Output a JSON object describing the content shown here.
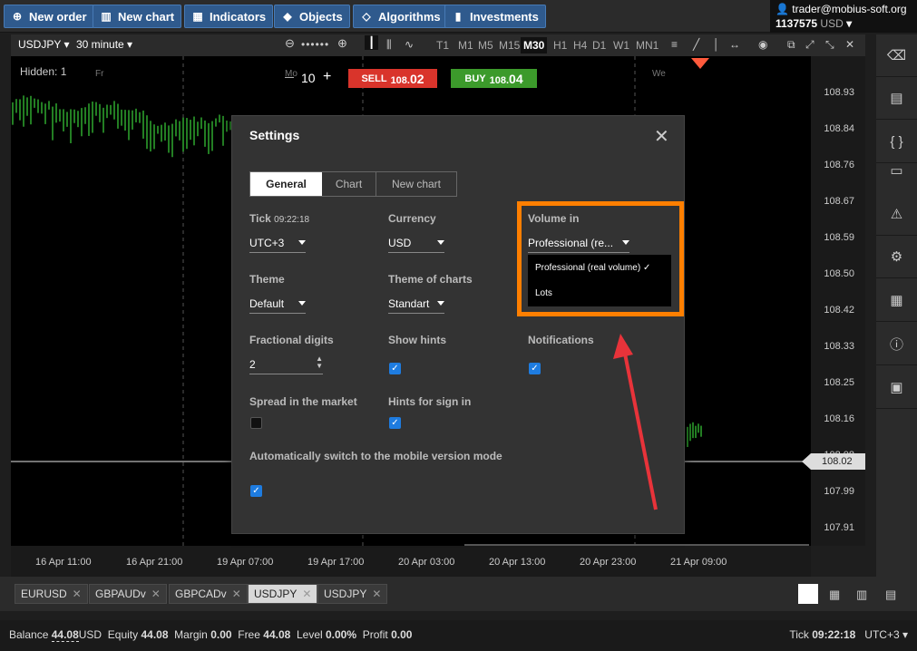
{
  "toolbar": {
    "new_order": "New order",
    "new_chart": "New chart",
    "indicators": "Indicators",
    "objects": "Objects",
    "algorithms": "Algorithms",
    "investments": "Investments"
  },
  "account": {
    "user": "trader@mobius-soft.org",
    "balance_line": "1137575",
    "currency": "USD"
  },
  "chart_toolbar": {
    "symbol": "USDJPY",
    "interval": "30 minute",
    "timeframes": [
      "T1",
      "M1",
      "M5",
      "M15",
      "M30",
      "H1",
      "H4",
      "D1",
      "W1",
      "MN1"
    ],
    "active_timeframe": "M30"
  },
  "chart": {
    "hidden_label": "Hidden: 1",
    "day_fr": "Fr",
    "day_mo": "Mo",
    "day_we": "We",
    "lot_value": "10",
    "sell_label": "SELL",
    "sell_price_main": "108.",
    "sell_price_big": "02",
    "buy_label": "BUY",
    "buy_price_main": "108.",
    "buy_price_big": "04",
    "price_levels": [
      "108.93",
      "108.84",
      "108.76",
      "108.67",
      "108.59",
      "108.50",
      "108.42",
      "108.33",
      "108.25",
      "108.16",
      "108.08",
      "107.99",
      "107.91"
    ],
    "current_price": "108.02",
    "time_labels": [
      "16 Apr 11:00",
      "16 Apr 21:00",
      "19 Apr 07:00",
      "19 Apr 17:00",
      "20 Apr 03:00",
      "20 Apr 13:00",
      "20 Apr 23:00",
      "21 Apr 09:00"
    ]
  },
  "tabs": [
    "EURUSD",
    "GBPAUDv",
    "GBPCADv",
    "USDJPY",
    "USDJPY"
  ],
  "active_tab_index": 3,
  "status": {
    "balance_label": "Balance",
    "balance": "44.08",
    "balance_cur": "USD",
    "equity_label": "Equity",
    "equity": "44.08",
    "margin_label": "Margin",
    "margin": "0.00",
    "free_label": "Free",
    "free": "44.08",
    "level_label": "Level",
    "level": "0.00%",
    "profit_label": "Profit",
    "profit": "0.00",
    "tick_label": "Tick",
    "tick_time": "09:22:18",
    "tz": "UTC+3"
  },
  "settings": {
    "title": "Settings",
    "tabs": [
      "General",
      "Chart",
      "New chart"
    ],
    "tick_label": "Tick",
    "tick_time": "09:22:18",
    "tick_value": "UTC+3",
    "currency_label": "Currency",
    "currency_value": "USD",
    "volume_label": "Volume in",
    "volume_value": "Professional (re...",
    "volume_options": [
      "Professional (real volume)",
      "Lots"
    ],
    "theme_label": "Theme",
    "theme_value": "Default",
    "theme_charts_label": "Theme of charts",
    "theme_charts_value": "Standart",
    "frac_label": "Fractional digits",
    "frac_value": "2",
    "hints_label": "Show hints",
    "notifications_label": "Notifications",
    "spread_label": "Spread in the market",
    "hints_signin_label": "Hints for sign in",
    "mobile_label": "Automatically switch to the mobile version mode"
  },
  "colors": {
    "accent_orange": "#ff7f00",
    "arrow_red": "#e8333a",
    "sell": "#d9342b",
    "buy": "#3c9a2b",
    "checkbox": "#1e7ce0"
  }
}
